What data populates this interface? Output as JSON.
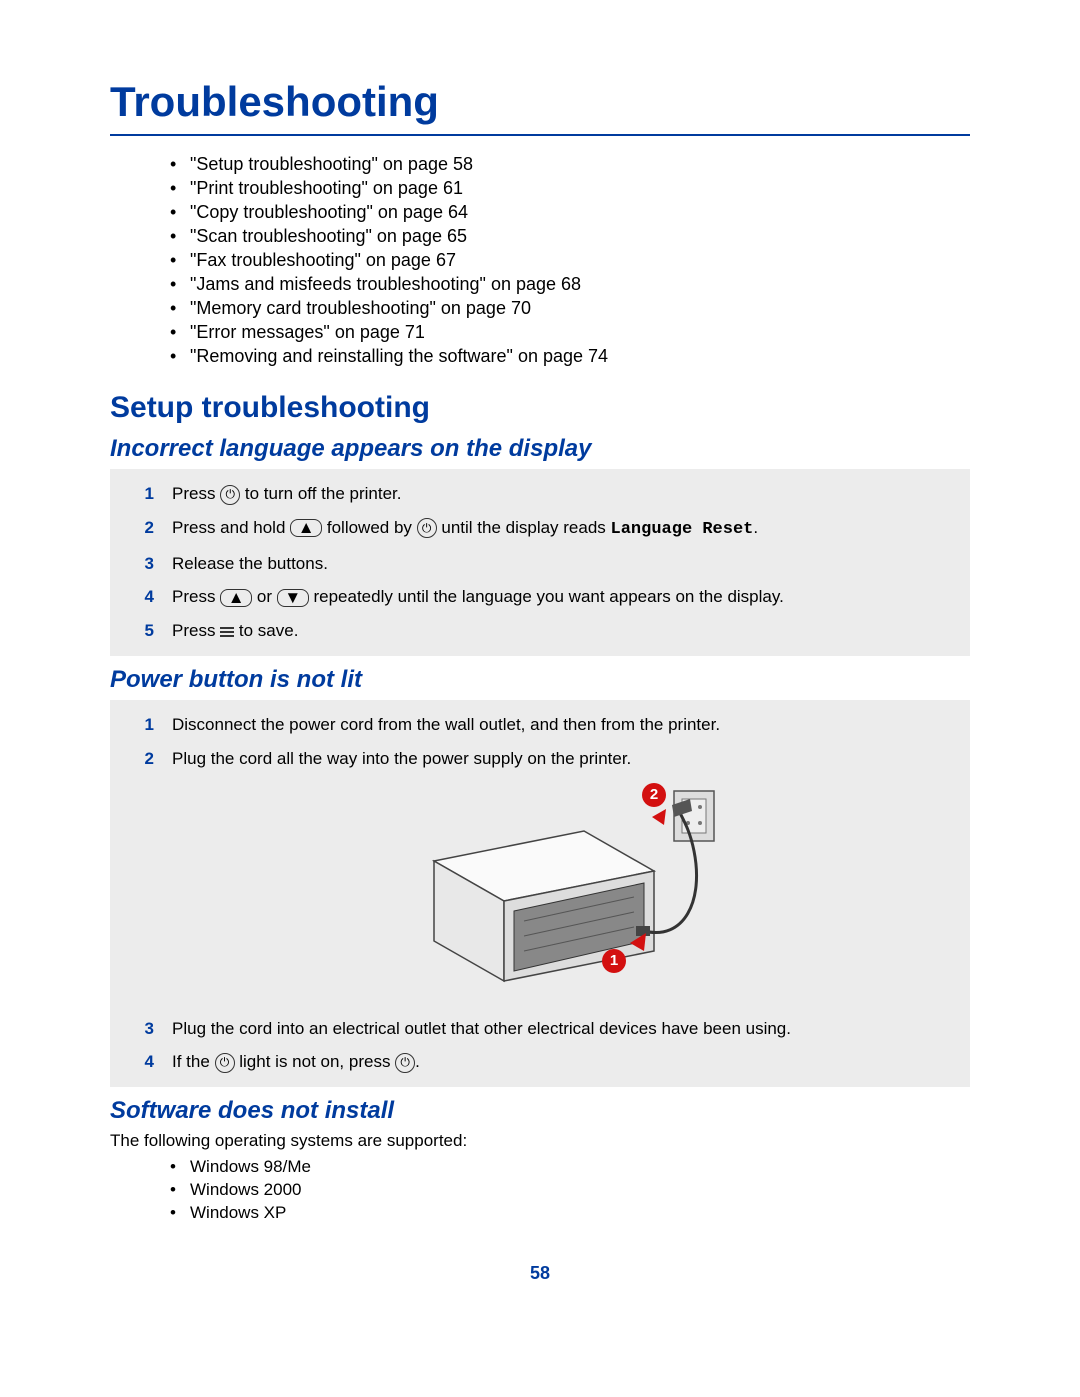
{
  "title": "Troubleshooting",
  "toc": [
    "\"Setup troubleshooting\" on page 58",
    "\"Print troubleshooting\" on page 61",
    "\"Copy troubleshooting\" on page 64",
    "\"Scan troubleshooting\" on page 65",
    "\"Fax troubleshooting\" on page 67",
    "\"Jams and misfeeds troubleshooting\" on page 68",
    "\"Memory card troubleshooting\" on page 70",
    "\"Error messages\" on page 71",
    "\"Removing and reinstalling the software\" on page 74"
  ],
  "section": "Setup troubleshooting",
  "sub1": {
    "heading": "Incorrect language appears on the display",
    "steps": {
      "s1a": "Press ",
      "s1b": " to turn off the printer.",
      "s2a": "Press and hold ",
      "s2b": " followed by ",
      "s2c": " until the display reads ",
      "s2d": "Language Reset",
      "s2e": ".",
      "s3": "Release the buttons.",
      "s4a": "Press ",
      "s4b": " or ",
      "s4c": " repeatedly until the language you want appears on the display.",
      "s5a": "Press ",
      "s5b": " to save."
    }
  },
  "sub2": {
    "heading": "Power button is not lit",
    "steps": {
      "s1": "Disconnect the power cord from the wall outlet, and then from the printer.",
      "s2": "Plug the cord all the way into the power supply on the printer.",
      "s3": "Plug the cord into an electrical outlet that other electrical devices have been using.",
      "s4a": "If the ",
      "s4b": " light is not on, press ",
      "s4c": "."
    },
    "badge1": "1",
    "badge2": "2"
  },
  "sub3": {
    "heading": "Software does not install",
    "intro": "The following operating systems are supported:",
    "os": [
      "Windows 98/Me",
      "Windows 2000",
      "Windows XP"
    ]
  },
  "page_number": "58"
}
